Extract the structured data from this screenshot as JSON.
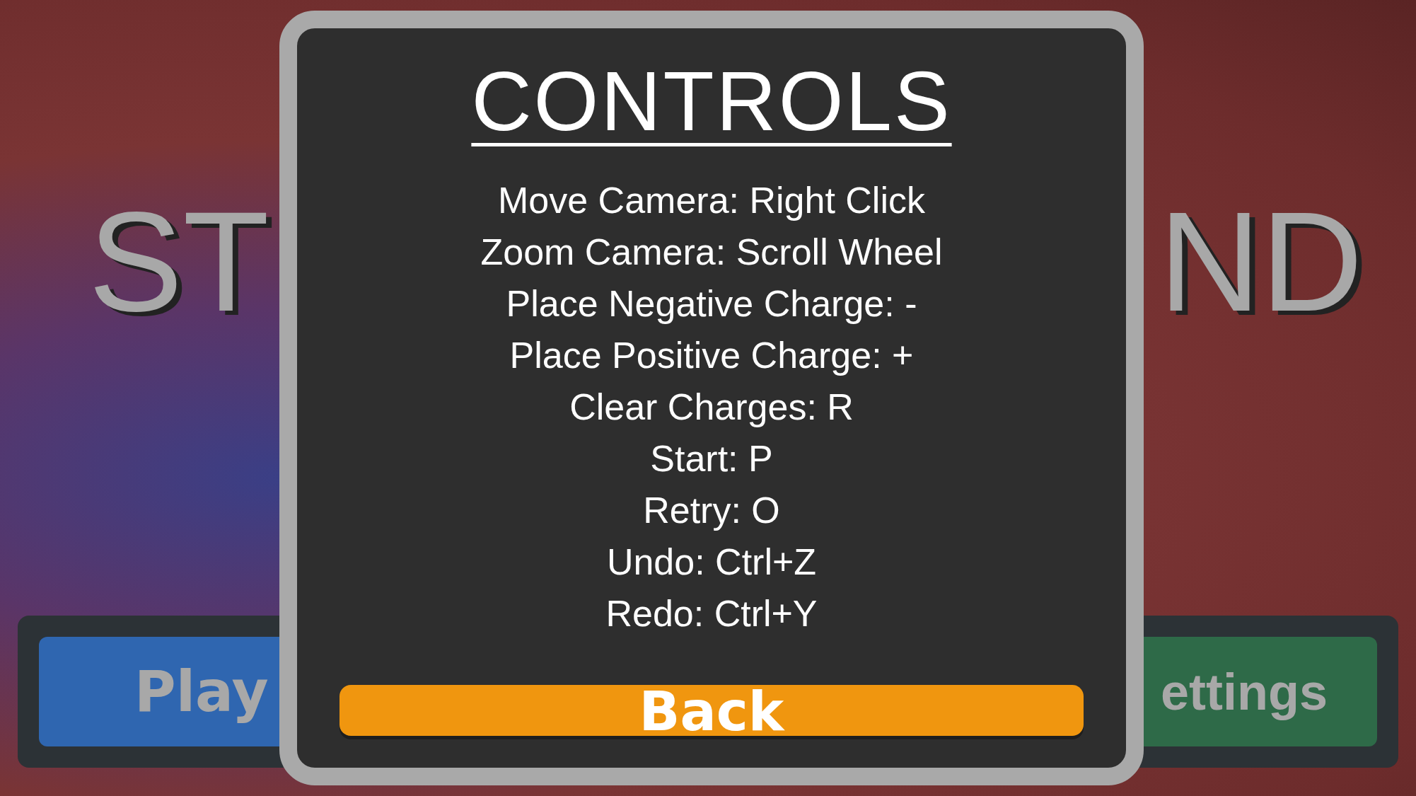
{
  "background": {
    "title_left": "ST",
    "title_right": "ND"
  },
  "menu_buttons": [
    {
      "label": "Play",
      "color": "#2f66b0"
    },
    {
      "label": "ettings",
      "color": "#2e6a48"
    }
  ],
  "dialog": {
    "title": "CONTROLS",
    "lines": [
      "Move Camera: Right Click",
      "Zoom Camera: Scroll Wheel",
      "Place Negative Charge: -",
      "Place Positive Charge: +",
      "Clear Charges: R",
      "Start: P",
      "Retry: O",
      "Undo: Ctrl+Z",
      "Redo: Ctrl+Y"
    ],
    "button": "Back"
  }
}
